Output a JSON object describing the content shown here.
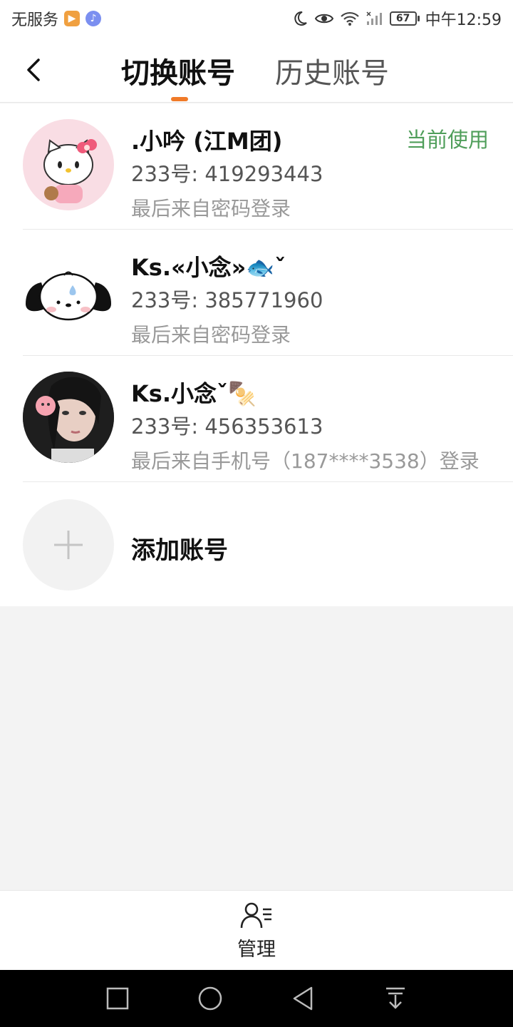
{
  "status_bar": {
    "carrier": "无服务",
    "time": "中午12:59",
    "battery": "67"
  },
  "header": {
    "tabs": [
      {
        "label": "切换账号",
        "active": true
      },
      {
        "label": "历史账号",
        "active": false
      }
    ],
    "accent_color": "#f07a28"
  },
  "accounts": [
    {
      "name": ".小吟  (江M团)",
      "uid": "233号: 419293443",
      "login": "最后来自密码登录",
      "current_label": "当前使用",
      "avatar": "hello-kitty-avatar"
    },
    {
      "name": "Ks.«小念»🐟ˇ",
      "uid": "233号: 385771960",
      "login": "最后来自密码登录",
      "avatar": "pochacco-avatar"
    },
    {
      "name": "Ks.小念ˇ🍢",
      "uid": "233号: 456353613",
      "login": "最后来自手机号（187****3538）登录",
      "avatar": "girl-photo-avatar"
    }
  ],
  "add_account": {
    "label": "添加账号"
  },
  "bottom": {
    "manage_label": "管理"
  },
  "colors": {
    "current": "#4f9e5a",
    "page_bg": "#f3f3f3"
  }
}
